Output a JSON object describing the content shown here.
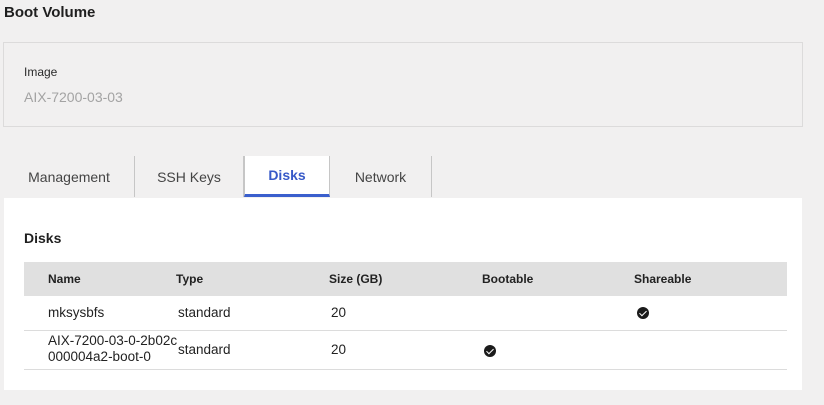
{
  "boot_volume": {
    "title": "Boot Volume",
    "image_label": "Image",
    "image_value": "AIX-7200-03-03"
  },
  "tabs": [
    {
      "label": "Management",
      "active": false
    },
    {
      "label": "SSH Keys",
      "active": false
    },
    {
      "label": "Disks",
      "active": true
    },
    {
      "label": "Network",
      "active": false
    }
  ],
  "disks": {
    "title": "Disks",
    "columns": [
      "Name",
      "Type",
      "Size (GB)",
      "Bootable",
      "Shareable"
    ],
    "rows": [
      {
        "name": "mksysbfs",
        "type": "standard",
        "size": "20",
        "bootable": false,
        "shareable": true
      },
      {
        "name": "AIX-7200-03-0-2b02c000004a2-boot-0",
        "type": "standard",
        "size": "20",
        "bootable": true,
        "shareable": false
      }
    ],
    "check_icon": "check-circle-icon"
  },
  "colors": {
    "accent": "#3a5fcd",
    "background": "#f1f0f0",
    "panel": "#ffffff",
    "table_header": "#e0e0e0"
  }
}
